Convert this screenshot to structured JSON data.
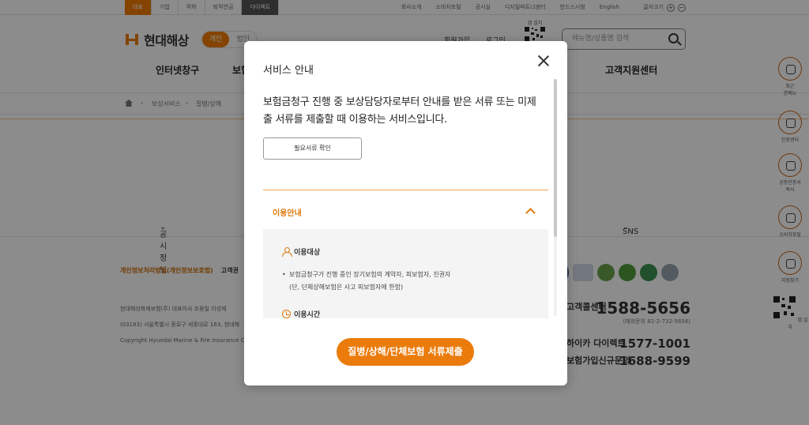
{
  "topbar": {
    "tabs": [
      "대표",
      "기업",
      "적하",
      "퇴직연금",
      "다이렉트"
    ],
    "utils": [
      "회사소개",
      "소비자포털",
      "공시실",
      "디지털파트너센터",
      "헌드스시청",
      "English"
    ],
    "font_label": "글자크기"
  },
  "header": {
    "logo_text": "현대해상",
    "seg_personal": "개인",
    "seg_corp": "법인",
    "join": "회원가입",
    "login": "로그인",
    "app_label": "앱 설치",
    "search_placeholder": "메뉴명/상품명 검색"
  },
  "gnb": [
    "인터넷창구",
    "보험",
    "고객지원센터"
  ],
  "breadcrumb": [
    "보상서비스",
    "질병/상해"
  ],
  "footer": {
    "nav": [
      "공시정보",
      "SNS"
    ],
    "privacy": "개인정보처리방침(개인정보보호법)",
    "link2": "고객권",
    "info_lines": [
      "현대해상화재보험(주)     대표이사 조용일 이성재",
      "(03183) 서울특별시 종로구 세종대로 163, 현대해",
      "Copyright Hyundai Marine & Fire Insurance Co."
    ],
    "contacts": [
      {
        "name": "고객콜센터",
        "number": "1588-5656",
        "sub": "(해외문의 82-2-732-5656)"
      },
      {
        "name": "하이카 다이렉트",
        "number": "1577-1001"
      },
      {
        "name": "보험가입신규문의",
        "number": "1688-9599"
      }
    ]
  },
  "quick_menu": [
    {
      "label": "최근\n본메뉴"
    },
    {
      "label": "인증센터"
    },
    {
      "label": "공동인증서\n복사"
    },
    {
      "label": "소비자포털"
    },
    {
      "label": "지점찾기"
    },
    {
      "label": "앱 설치"
    }
  ],
  "modal": {
    "title": "서비스 안내",
    "description": "보험금청구 진행 중 보상담당자로부터 안내를 받은 서류 또는 미제출 서류를 제출할 때 이용하는 서비스입니다.",
    "docs_button": "필요서류 확인",
    "accordion_label": "이용안내",
    "section1_title": "이용대상",
    "section1_line1": "보험금청구가 진행 중인 장기보험의 계약자, 피보험자, 친권자",
    "section1_line2": "(단, 단체상해보험은 사고 피보험자에 한함)",
    "section2_title": "이용시간",
    "submit_button": "질병/상해/단체보험 서류제출"
  }
}
